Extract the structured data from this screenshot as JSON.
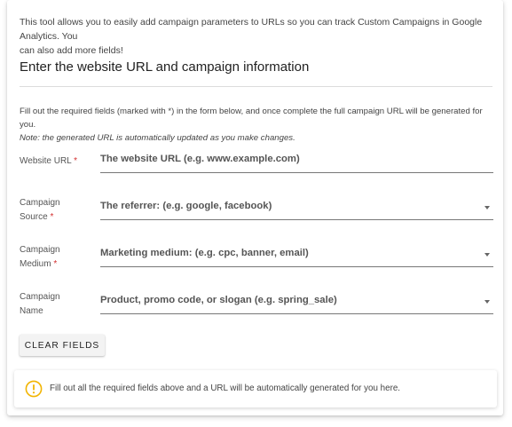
{
  "intro": {
    "line1": "This tool allows you to easily add campaign parameters to URLs so you can track Custom Campaigns in Google Analytics. You",
    "line2": "can also add more fields!"
  },
  "heading": "Enter the website URL and campaign information",
  "instructions": {
    "text": "Fill out the required fields (marked with *) in the form below, and once complete the full campaign URL will be generated for you.",
    "note": "Note: the generated URL is automatically updated as you make changes."
  },
  "fields": [
    {
      "label_line1": "Website URL",
      "label_line2": "",
      "required_mark": "*",
      "placeholder": "The website URL (e.g. www.example.com)",
      "dropdown": false
    },
    {
      "label_line1": "Campaign",
      "label_line2": "Source",
      "required_mark": "*",
      "placeholder": "The referrer: (e.g. google, facebook)",
      "dropdown": true
    },
    {
      "label_line1": "Campaign",
      "label_line2": "Medium",
      "required_mark": "*",
      "placeholder": "Marketing medium: (e.g. cpc, banner, email)",
      "dropdown": true
    },
    {
      "label_line1": "Campaign",
      "label_line2": "Name",
      "required_mark": "",
      "placeholder": "Product, promo code, or slogan (e.g. spring_sale)",
      "dropdown": true
    }
  ],
  "clear_button": "CLEAR FIELDS",
  "alert": {
    "icon": "warning-circle-icon",
    "text": "Fill out all the required fields above and a URL will be automatically generated for you here."
  },
  "colors": {
    "required": "#d32f2f",
    "warning": "#f2b400"
  }
}
